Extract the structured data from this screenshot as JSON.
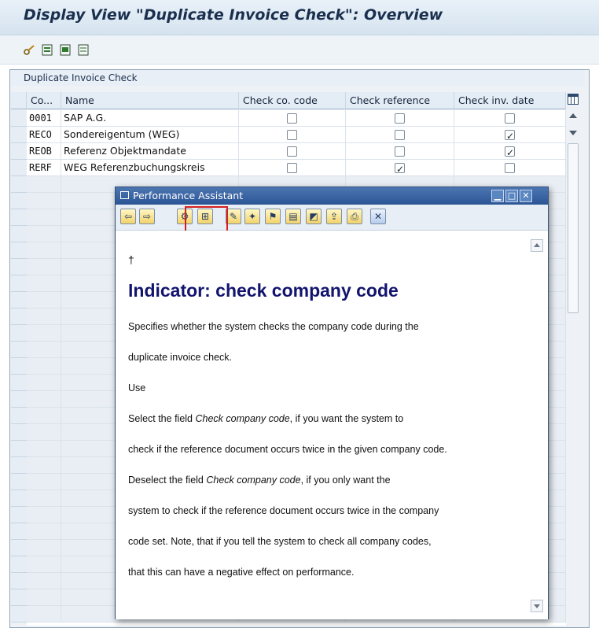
{
  "window": {
    "title": "Display View \"Duplicate Invoice Check\": Overview"
  },
  "toolbar": {
    "icons": [
      "edit-glasses-icon",
      "select-all-icon",
      "select-block-icon",
      "deselect-all-icon"
    ]
  },
  "table": {
    "title": "Duplicate Invoice Check",
    "columns": [
      "Co...",
      "Name",
      "Check co. code",
      "Check reference",
      "Check inv. date"
    ],
    "rows": [
      {
        "code": "0001",
        "name": "SAP A.G.",
        "check_cocode": false,
        "check_ref": false,
        "check_date": false
      },
      {
        "code": "RECO",
        "name": "Sondereigentum (WEG)",
        "check_cocode": false,
        "check_ref": false,
        "check_date": true
      },
      {
        "code": "REOB",
        "name": "Referenz Objektmandate",
        "check_cocode": false,
        "check_ref": false,
        "check_date": true
      },
      {
        "code": "RERF",
        "name": "WEG Referenzbuchungskreis",
        "check_cocode": false,
        "check_ref": true,
        "check_date": false
      }
    ]
  },
  "performance_assistant": {
    "title": "Performance Assistant",
    "marker": "†",
    "heading": "Indicator: check company code",
    "lines": [
      "Specifies whether the system checks the company code during the",
      "duplicate invoice check.",
      "Use"
    ],
    "p2_pre": "Select the field ",
    "p2_em": "Check company code",
    "p2_post": ", if you want the system to",
    "p2_line2": "check if the reference document occurs twice in the given company code.",
    "p3_pre": "Deselect the field ",
    "p3_em": "Check company code",
    "p3_post": ", if you only want the",
    "p3_line2": "system to check if the reference document occurs twice in the company",
    "p3_line3": "code set. Note, that if you tell the system to check all company codes,",
    "p3_line4": "that this can have a negative effect on performance."
  },
  "colors": {
    "accent": "#2a5494",
    "heading": "#12146e",
    "highlight": "#d42020"
  }
}
